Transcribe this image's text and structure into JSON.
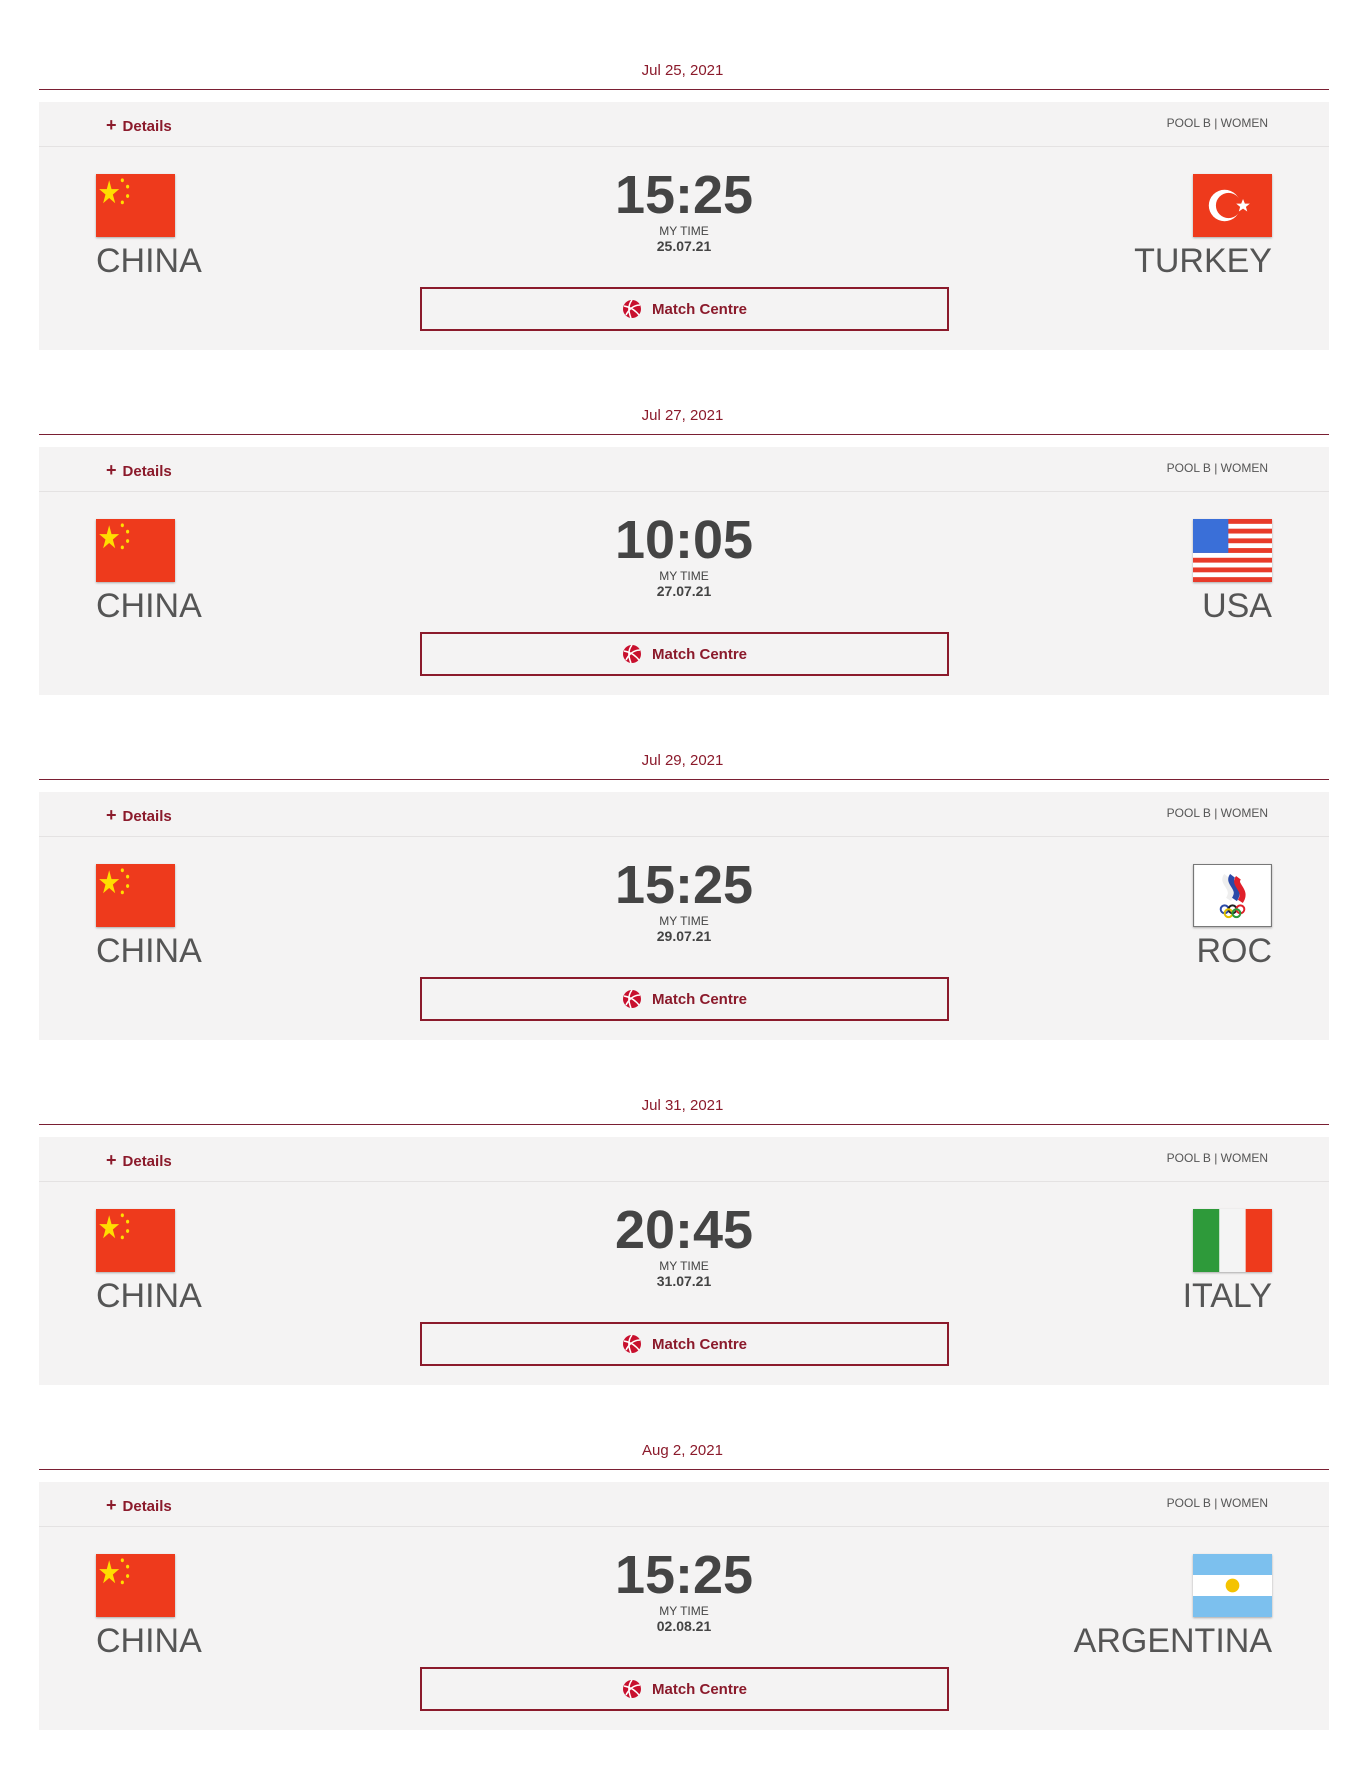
{
  "details_label": "Details",
  "button_label": "Match Centre",
  "my_time_label": "MY TIME",
  "colors": {
    "accent": "#8b1a2b",
    "card_bg": "#f4f3f3"
  },
  "matches": [
    {
      "date": "Jul 25, 2021",
      "pool": "POOL B | WOMEN",
      "home": "CHINA",
      "away": "TURKEY",
      "time": "15:25",
      "local_date": "25.07.21",
      "home_flag": "china-flag",
      "away_flag": "turkey-flag"
    },
    {
      "date": "Jul 27, 2021",
      "pool": "POOL B | WOMEN",
      "home": "CHINA",
      "away": "USA",
      "time": "10:05",
      "local_date": "27.07.21",
      "home_flag": "china-flag",
      "away_flag": "usa-flag"
    },
    {
      "date": "Jul 29, 2021",
      "pool": "POOL B | WOMEN",
      "home": "CHINA",
      "away": "ROC",
      "time": "15:25",
      "local_date": "29.07.21",
      "home_flag": "china-flag",
      "away_flag": "roc-flag"
    },
    {
      "date": "Jul 31, 2021",
      "pool": "POOL B | WOMEN",
      "home": "CHINA",
      "away": "ITALY",
      "time": "20:45",
      "local_date": "31.07.21",
      "home_flag": "china-flag",
      "away_flag": "italy-flag"
    },
    {
      "date": "Aug 2, 2021",
      "pool": "POOL B | WOMEN",
      "home": "CHINA",
      "away": "ARGENTINA",
      "time": "15:25",
      "local_date": "02.08.21",
      "home_flag": "china-flag",
      "away_flag": "argentina-flag"
    }
  ]
}
